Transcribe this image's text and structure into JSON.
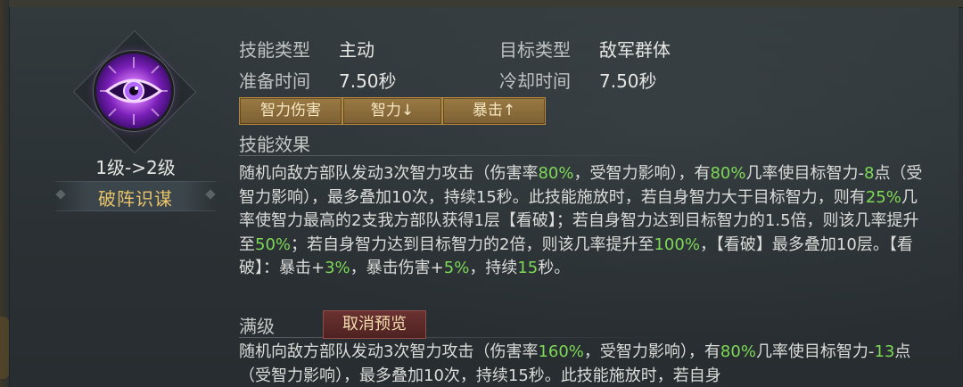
{
  "skill": {
    "level_text": "1级->2级",
    "name": "破阵识谋"
  },
  "info": {
    "type_label": "技能类型",
    "type_value": "主动",
    "target_label": "目标类型",
    "target_value": "敌军群体",
    "prep_label": "准备时间",
    "prep_value": "7.50秒",
    "cooldown_label": "冷却时间",
    "cooldown_value": "7.50秒"
  },
  "tags": [
    "智力伤害",
    "智力↓",
    "暴击↑"
  ],
  "effect": {
    "title": "技能效果",
    "segments": [
      {
        "t": "随机向敌方部队发动3次智力攻击（伤害率"
      },
      {
        "t": "80%",
        "g": true
      },
      {
        "t": "，受智力影响），有"
      },
      {
        "t": "80%",
        "g": true
      },
      {
        "t": "几率使目标智力-"
      },
      {
        "t": "8",
        "g": true
      },
      {
        "t": "点（受智力影响），最多叠加10次，持续15秒。此技能施放时，若自身智力大于目标智力，则有"
      },
      {
        "t": "25%",
        "g": true
      },
      {
        "t": "几率使智力最高的2支我方部队获得1层【看破】；若自身智力达到目标智力的1.5倍，则该几率提升至"
      },
      {
        "t": "50%",
        "g": true
      },
      {
        "t": "；若自身智力达到目标智力的2倍，则该几率提升至"
      },
      {
        "t": "100%",
        "g": true
      },
      {
        "t": "，【看破】最多叠加10层。【看破】：暴击+"
      },
      {
        "t": "3%",
        "g": true
      },
      {
        "t": "，暴击伤害+"
      },
      {
        "t": "5%",
        "g": true
      },
      {
        "t": "，持续"
      },
      {
        "t": "15",
        "g": true
      },
      {
        "t": "秒。"
      }
    ]
  },
  "max": {
    "title": "满级",
    "cancel_label": "取消预览",
    "segments": [
      {
        "t": "随机向敌方部队发动3次智力攻击（伤害率"
      },
      {
        "t": "160%",
        "g": true
      },
      {
        "t": "，受智力影响），有"
      },
      {
        "t": "80%",
        "g": true
      },
      {
        "t": "几率使目标智力-"
      },
      {
        "t": "13",
        "g": true
      },
      {
        "t": "点（受智力影响），最多叠加10次，持续15秒。此技能施放时，若自身"
      }
    ]
  },
  "colors": {
    "highlight": "#7ed957",
    "gold": "#e8c46a",
    "tag_bg": "#8a6b3b",
    "cancel_bg": "#5a2a29"
  },
  "icons": {
    "skill_icon": "purple-eye-icon"
  }
}
